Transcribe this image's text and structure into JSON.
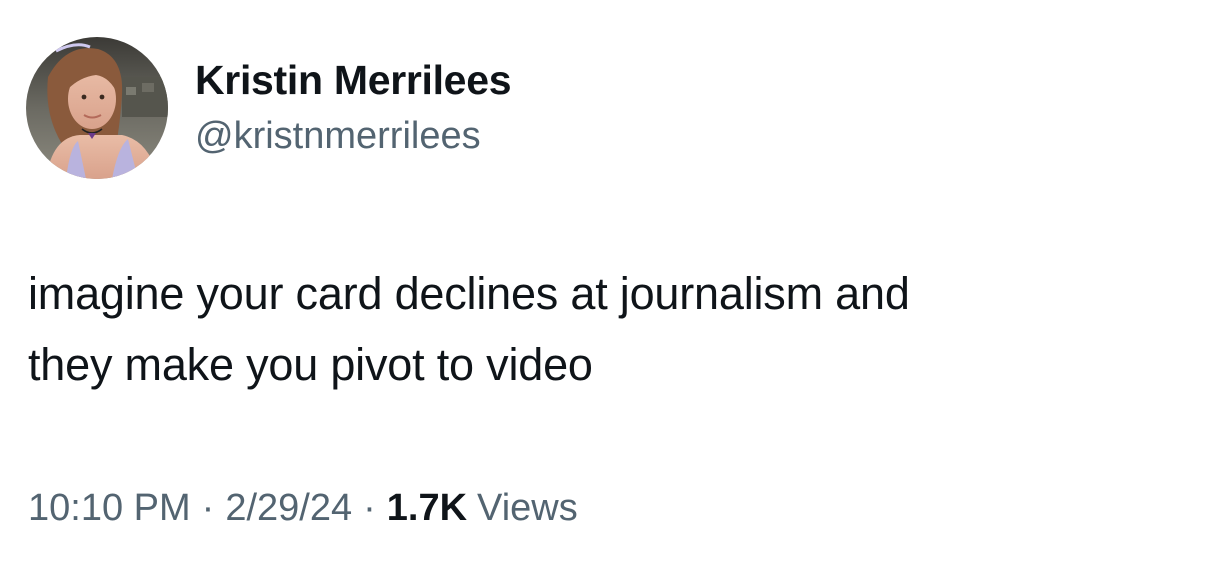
{
  "author": {
    "display_name": "Kristin Merrilees",
    "handle": "@kristnmerrilees"
  },
  "tweet": {
    "text_line_1": "imagine your card declines at journalism and",
    "text_line_2": "they make you pivot to video"
  },
  "meta": {
    "time": "10:10 PM",
    "separator": "·",
    "date": "2/29/24",
    "views_count": "1.7K",
    "views_label": "Views"
  }
}
